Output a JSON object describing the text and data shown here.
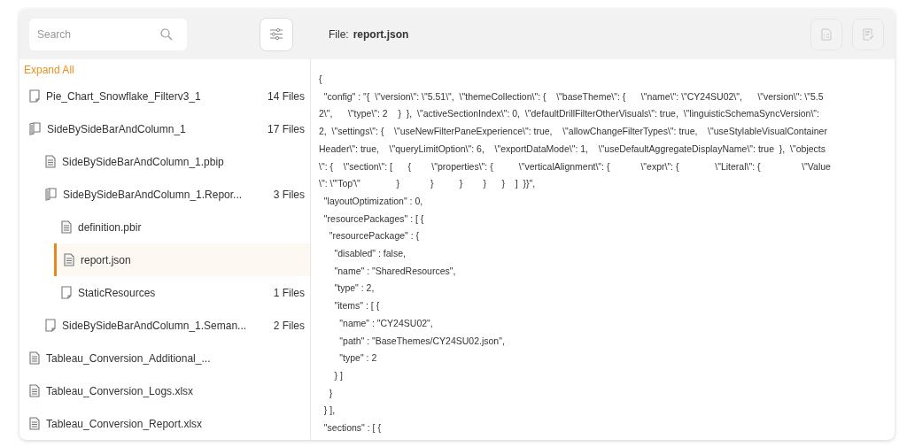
{
  "header": {
    "search": {
      "placeholder": "Search"
    },
    "file_label": "File:",
    "file_name": "report.json",
    "actions": [
      {
        "kind": "checklist",
        "disabled": true
      },
      {
        "kind": "edit",
        "disabled": true
      }
    ]
  },
  "tree": {
    "expand_all": "Expand All",
    "items": [
      {
        "kind": "folder",
        "label": "Pie_Chart_Snowflake_Filterv3_1",
        "count": "14 Files",
        "selected": false
      },
      {
        "kind": "book",
        "label": "SideBySideBarAndColumn_1",
        "count": "17 Files",
        "selected": false,
        "children": [
          {
            "kind": "file",
            "label": "SideBySideBarAndColumn_1.pbip",
            "selected": false
          },
          {
            "kind": "book",
            "label": "SideBySideBarAndColumn_1.Repor...",
            "count": "3 Files",
            "selected": false,
            "children": [
              {
                "kind": "file",
                "label": "definition.pbir",
                "selected": false
              },
              {
                "kind": "file",
                "label": "report.json",
                "selected": true
              },
              {
                "kind": "folder",
                "label": "StaticResources",
                "count": "1 Files",
                "selected": false
              }
            ]
          },
          {
            "kind": "folder",
            "label": "SideBySideBarAndColumn_1.Seman...",
            "count": "2 Files",
            "selected": false
          }
        ]
      },
      {
        "kind": "file",
        "label": "Tableau_Conversion_Additional_...",
        "selected": false
      },
      {
        "kind": "file",
        "label": "Tableau_Conversion_Logs.xlsx",
        "selected": false
      },
      {
        "kind": "file",
        "label": "Tableau_Conversion_Report.xlsx",
        "selected": false
      }
    ]
  },
  "code": [
    {
      "lines": [
        "{"
      ]
    },
    {
      "lines": [
        "  \"config\" : \"{  \\\"version\\\": \\\"5.51\\\",  \\\"themeCollection\\\": {    \\\"baseTheme\\\": {      \\\"name\\\": \\\"CY24SU02\\\",      \\\"version\\\": \\\"5.5",
        "2\\\",      \\\"type\\\": 2    }  },  \\\"activeSectionIndex\\\": 0,  \\\"defaultDrillFilterOtherVisuals\\\": true,  \\\"linguisticSchemaSyncVersion\\\":",
        "2,  \\\"settings\\\": {    \\\"useNewFilterPaneExperience\\\": true,    \\\"allowChangeFilterTypes\\\": true,    \\\"useStylableVisualContainer",
        "Header\\\": true,    \\\"queryLimitOption\\\": 6,    \\\"exportDataMode\\\": 1,    \\\"useDefaultAggregateDisplayName\\\": true  },  \\\"objects",
        "\\\": {    \\\"section\\\": [      {        \\\"properties\\\": {          \\\"verticalAlignment\\\": {            \\\"expr\\\": {              \\\"Literal\\\": {                \\\"Value",
        "\\\": \\\"'Top'\\\"              }            }          }        }      }    ]  }}\","
      ]
    },
    {
      "lines": [
        "  \"layoutOptimization\" : 0,"
      ]
    },
    {
      "lines": [
        "  \"resourcePackages\" : [ {"
      ]
    },
    {
      "lines": [
        "    \"resourcePackage\" : {"
      ]
    },
    {
      "lines": [
        "      \"disabled\" : false,"
      ]
    },
    {
      "lines": [
        "      \"name\" : \"SharedResources\","
      ]
    },
    {
      "lines": [
        "      \"type\" : 2,"
      ]
    },
    {
      "lines": [
        "      \"items\" : [ {"
      ]
    },
    {
      "lines": [
        "        \"name\" : \"CY24SU02\","
      ]
    },
    {
      "lines": [
        "        \"path\" : \"BaseThemes/CY24SU02.json\","
      ]
    },
    {
      "lines": [
        "        \"type\" : 2"
      ]
    },
    {
      "lines": [
        "      } ]"
      ]
    },
    {
      "lines": [
        "    }"
      ]
    },
    {
      "lines": [
        "  } ],"
      ]
    },
    {
      "lines": [
        "  \"sections\" : [ {"
      ]
    }
  ]
}
